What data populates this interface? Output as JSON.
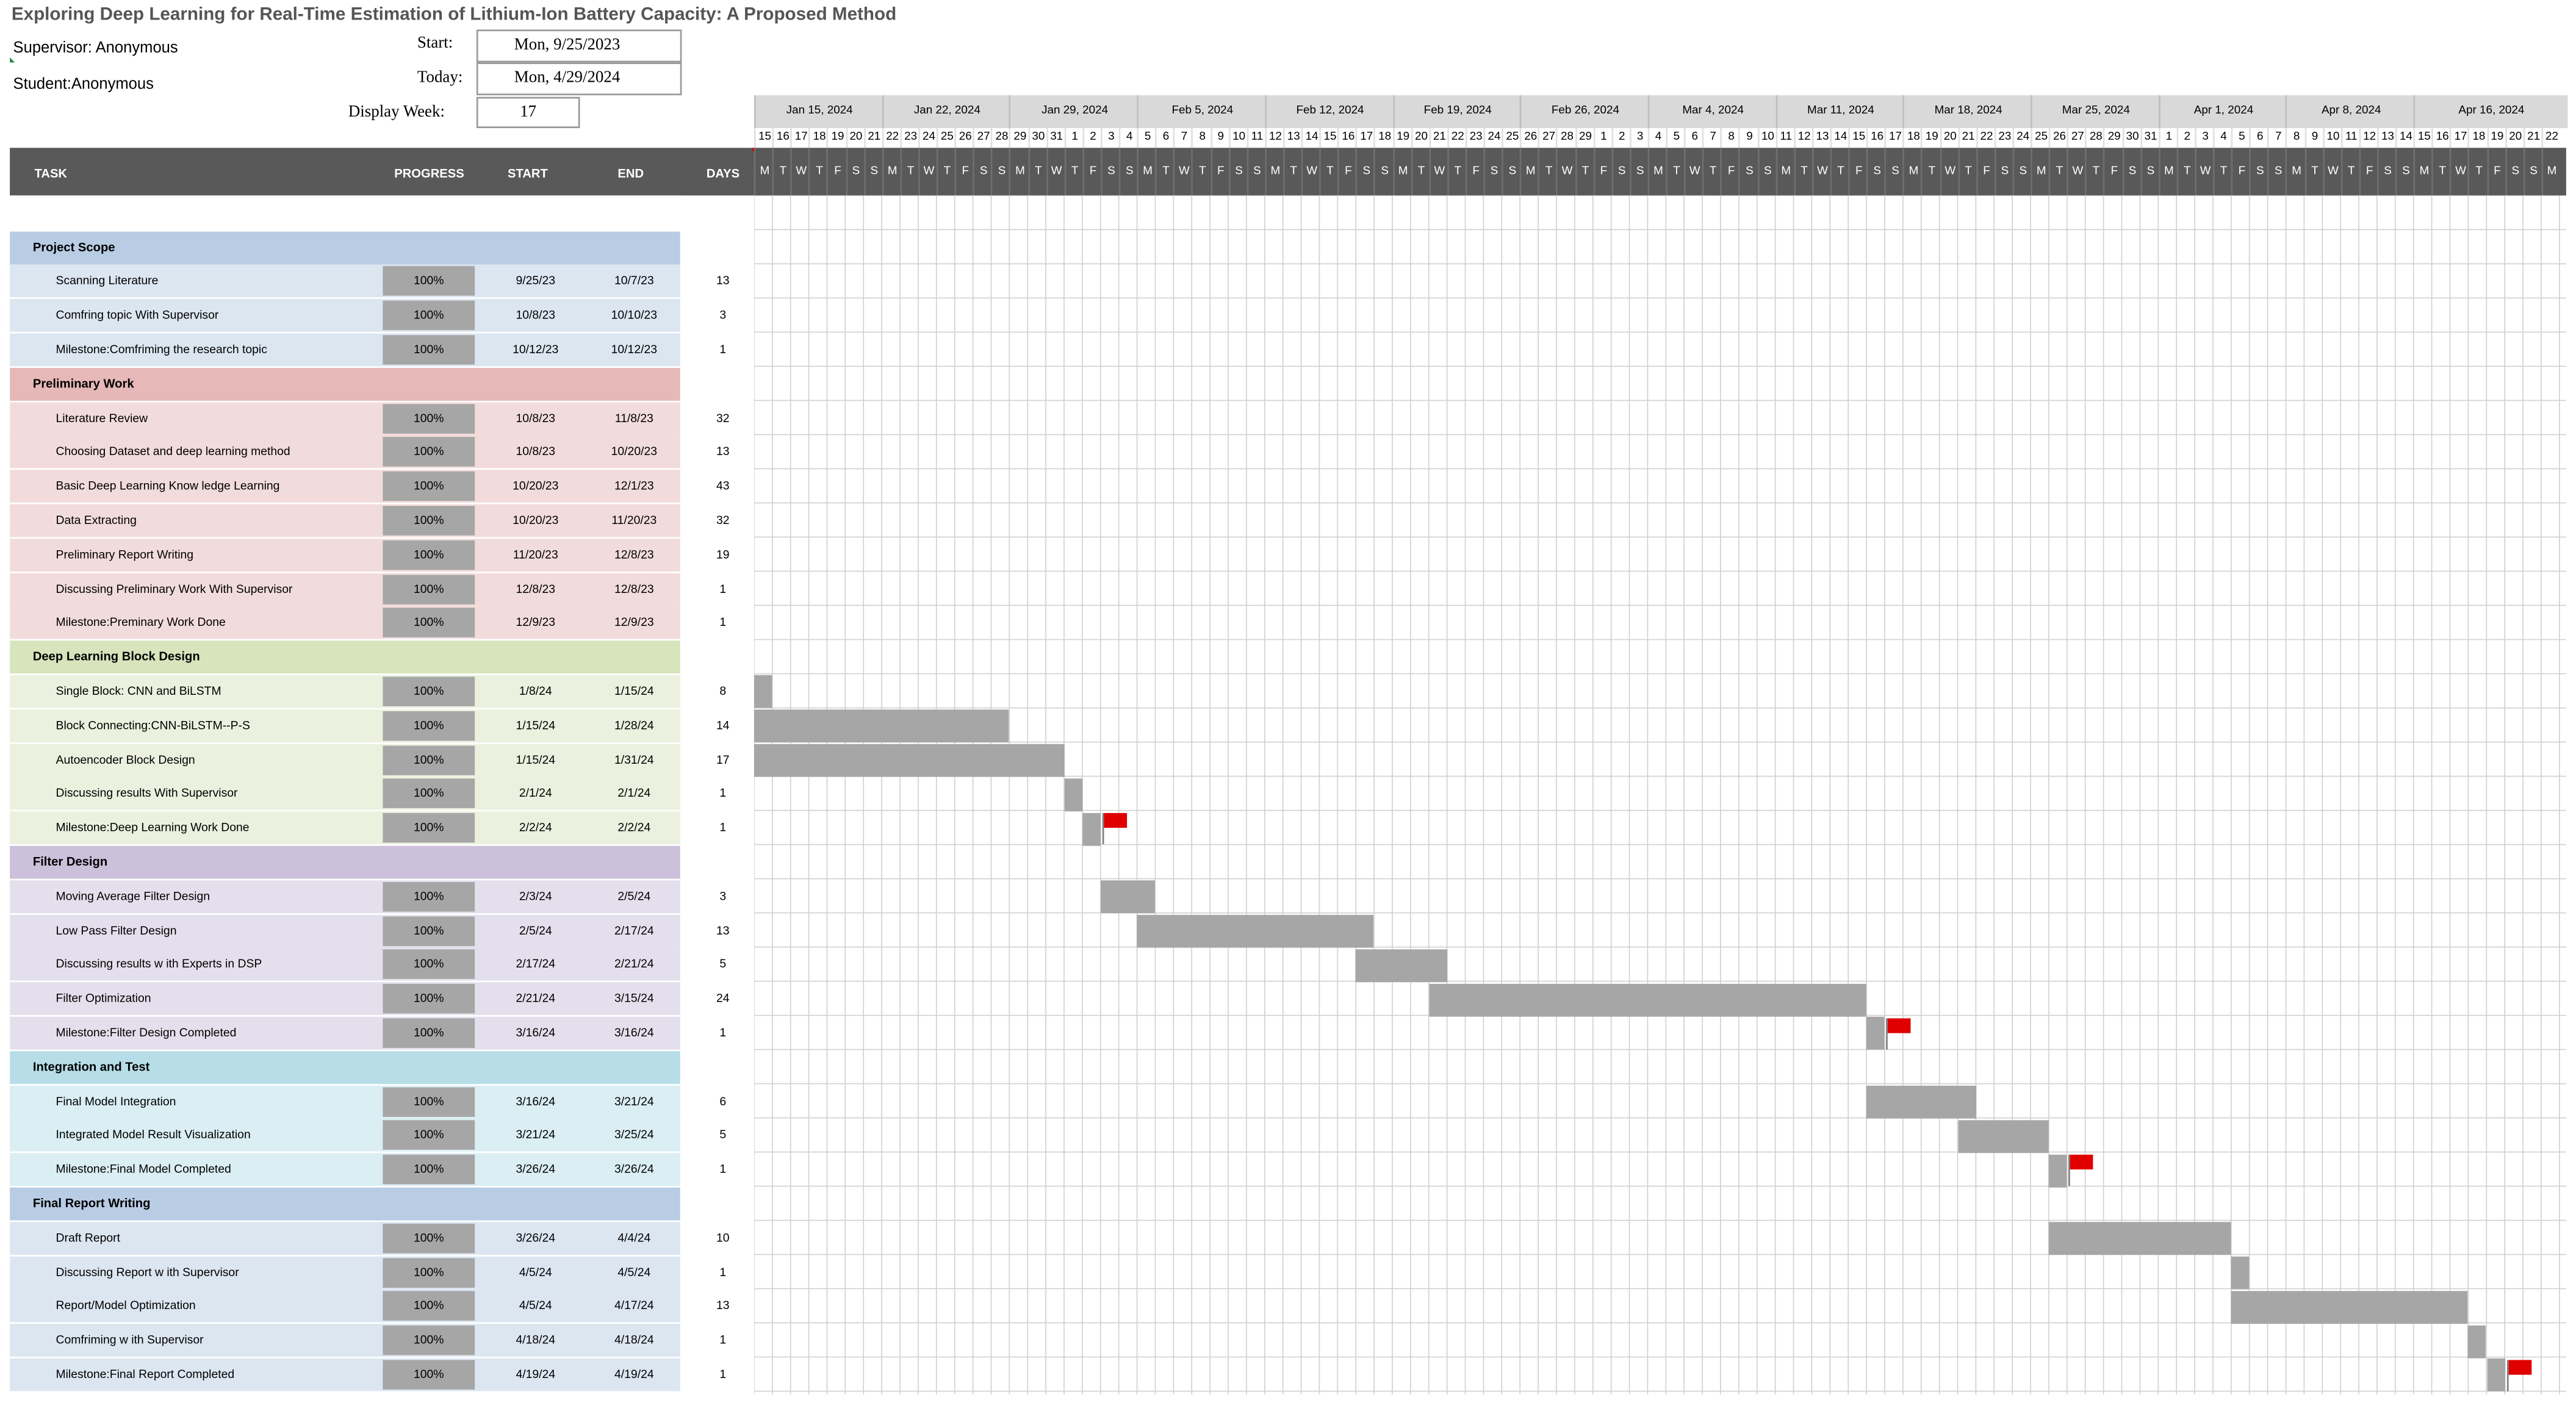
{
  "header": {
    "title": "Exploring Deep Learning for Real-Time Estimation of Lithium-Ion Battery Capacity: A Proposed Method",
    "supervisor": "Supervisor: Anonymous",
    "student": "Student:Anonymous",
    "start_label": "Start:",
    "start_value": "Mon, 9/25/2023",
    "today_label": "Today:",
    "today_value": "Mon, 4/29/2024",
    "week_label": "Display Week:",
    "week_value": "17"
  },
  "columns": {
    "task": "TASK",
    "progress": "PROGRESS",
    "start": "START",
    "end": "END",
    "days": "DAYS"
  },
  "timeline": {
    "weeks": [
      "Jan 15, 2024",
      "Jan 22, 2024",
      "Jan 29, 2024",
      "Feb 5, 2024",
      "Feb 12, 2024",
      "Feb 19, 2024",
      "Feb 26, 2024",
      "Mar 4, 2024",
      "Mar 11, 2024",
      "Mar 18, 2024",
      "Mar 25, 2024",
      "Apr 1, 2024",
      "Apr 8, 2024",
      "Apr 16, 2024"
    ],
    "day_numbers": [
      "15",
      "16",
      "17",
      "18",
      "19",
      "20",
      "21",
      "22",
      "23",
      "24",
      "25",
      "26",
      "27",
      "28",
      "29",
      "30",
      "31",
      "1",
      "2",
      "3",
      "4",
      "5",
      "6",
      "7",
      "8",
      "9",
      "10",
      "11",
      "12",
      "13",
      "14",
      "15",
      "16",
      "17",
      "18",
      "19",
      "20",
      "21",
      "22",
      "23",
      "24",
      "25",
      "26",
      "27",
      "28",
      "29",
      "1",
      "2",
      "3",
      "4",
      "5",
      "6",
      "7",
      "8",
      "9",
      "10",
      "11",
      "12",
      "13",
      "14",
      "15",
      "16",
      "17",
      "18",
      "19",
      "20",
      "21",
      "22",
      "23",
      "24",
      "25",
      "26",
      "27",
      "28",
      "29",
      "30",
      "31",
      "1",
      "2",
      "3",
      "4",
      "5",
      "6",
      "7",
      "8",
      "9",
      "10",
      "11",
      "12",
      "13",
      "14",
      "15",
      "16",
      "17",
      "18",
      "19",
      "20",
      "21",
      "22"
    ],
    "day_letters": [
      "M",
      "T",
      "W",
      "T",
      "F",
      "S",
      "S"
    ]
  },
  "sections": [
    {
      "name": "Project Scope",
      "color": "#b8cce4",
      "row_color": "#dce6f1",
      "tasks": [
        {
          "task": "Scanning Literature",
          "progress": "100%",
          "start": "9/25/23",
          "end": "10/7/23",
          "days": "13"
        },
        {
          "task": "Comfring topic With Supervisor",
          "progress": "100%",
          "start": "10/8/23",
          "end": "10/10/23",
          "days": "3"
        },
        {
          "task": "Milestone:Comfriming the research topic",
          "progress": "100%",
          "start": "10/12/23",
          "end": "10/12/23",
          "days": "1"
        }
      ]
    },
    {
      "name": "Preliminary Work",
      "color": "#e6b8b7",
      "row_color": "#f2dcdb",
      "tasks": [
        {
          "task": "Literature Review",
          "progress": "100%",
          "start": "10/8/23",
          "end": "11/8/23",
          "days": "32"
        },
        {
          "task": "Choosing Dataset and deep learning method",
          "progress": "100%",
          "start": "10/8/23",
          "end": "10/20/23",
          "days": "13"
        },
        {
          "task": "Basic Deep Learning Know ledge Learning",
          "progress": "100%",
          "start": "10/20/23",
          "end": "12/1/23",
          "days": "43"
        },
        {
          "task": "Data Extracting",
          "progress": "100%",
          "start": "10/20/23",
          "end": "11/20/23",
          "days": "32"
        },
        {
          "task": "Preliminary Report Writing",
          "progress": "100%",
          "start": "11/20/23",
          "end": "12/8/23",
          "days": "19"
        },
        {
          "task": "Discussing Preliminary Work With Supervisor",
          "progress": "100%",
          "start": "12/8/23",
          "end": "12/8/23",
          "days": "1"
        },
        {
          "task": "Milestone:Preminary Work Done",
          "progress": "100%",
          "start": "12/9/23",
          "end": "12/9/23",
          "days": "1"
        }
      ]
    },
    {
      "name": "Deep Learning Block Design",
      "color": "#d8e4bc",
      "row_color": "#ebf1de",
      "tasks": [
        {
          "task": "Single Block: CNN and BiLSTM",
          "progress": "100%",
          "start": "1/8/24",
          "end": "1/15/24",
          "days": "8"
        },
        {
          "task": "Block Connecting:CNN-BiLSTM--P-S",
          "progress": "100%",
          "start": "1/15/24",
          "end": "1/28/24",
          "days": "14"
        },
        {
          "task": "Autoencoder Block Design",
          "progress": "100%",
          "start": "1/15/24",
          "end": "1/31/24",
          "days": "17"
        },
        {
          "task": "Discussing results With Supervisor",
          "progress": "100%",
          "start": "2/1/24",
          "end": "2/1/24",
          "days": "1"
        },
        {
          "task": "Milestone:Deep Learning Work Done",
          "progress": "100%",
          "start": "2/2/24",
          "end": "2/2/24",
          "days": "1"
        }
      ]
    },
    {
      "name": "Filter Design",
      "color": "#ccc0da",
      "row_color": "#e4dfec",
      "tasks": [
        {
          "task": "Moving Average Filter Design",
          "progress": "100%",
          "start": "2/3/24",
          "end": "2/5/24",
          "days": "3"
        },
        {
          "task": "Low  Pass Filter Design",
          "progress": "100%",
          "start": "2/5/24",
          "end": "2/17/24",
          "days": "13"
        },
        {
          "task": "Discussing results w ith Experts in DSP",
          "progress": "100%",
          "start": "2/17/24",
          "end": "2/21/24",
          "days": "5"
        },
        {
          "task": "Filter Optimization",
          "progress": "100%",
          "start": "2/21/24",
          "end": "3/15/24",
          "days": "24"
        },
        {
          "task": "Milestone:Filter Design Completed",
          "progress": "100%",
          "start": "3/16/24",
          "end": "3/16/24",
          "days": "1"
        }
      ]
    },
    {
      "name": "Integration and Test",
      "color": "#b7dee8",
      "row_color": "#daeef3",
      "tasks": [
        {
          "task": "Final Model Integration",
          "progress": "100%",
          "start": "3/16/24",
          "end": "3/21/24",
          "days": "6"
        },
        {
          "task": "Integrated Model Result Visualization",
          "progress": "100%",
          "start": "3/21/24",
          "end": "3/25/24",
          "days": "5"
        },
        {
          "task": "Milestone:Final Model Completed",
          "progress": "100%",
          "start": "3/26/24",
          "end": "3/26/24",
          "days": "1"
        }
      ]
    },
    {
      "name": "Final Report Writing",
      "color": "#b8cce4",
      "row_color": "#dce6f1",
      "tasks": [
        {
          "task": "Draft Report",
          "progress": "100%",
          "start": "3/26/24",
          "end": "4/4/24",
          "days": "10"
        },
        {
          "task": "Discussing Report w ith Supervisor",
          "progress": "100%",
          "start": "4/5/24",
          "end": "4/5/24",
          "days": "1"
        },
        {
          "task": "Report/Model Optimization",
          "progress": "100%",
          "start": "4/5/24",
          "end": "4/17/24",
          "days": "13"
        },
        {
          "task": "Comfriming w ith Supervisor",
          "progress": "100%",
          "start": "4/18/24",
          "end": "4/18/24",
          "days": "1"
        },
        {
          "task": "Milestone:Final Report Completed",
          "progress": "100%",
          "start": "4/19/24",
          "end": "4/19/24",
          "days": "1"
        }
      ]
    }
  ],
  "colors": {
    "header_bg": "#595959",
    "bar": "#a6a6a6",
    "flag": "#e00000",
    "week_bg": "#d9d9d9"
  }
}
